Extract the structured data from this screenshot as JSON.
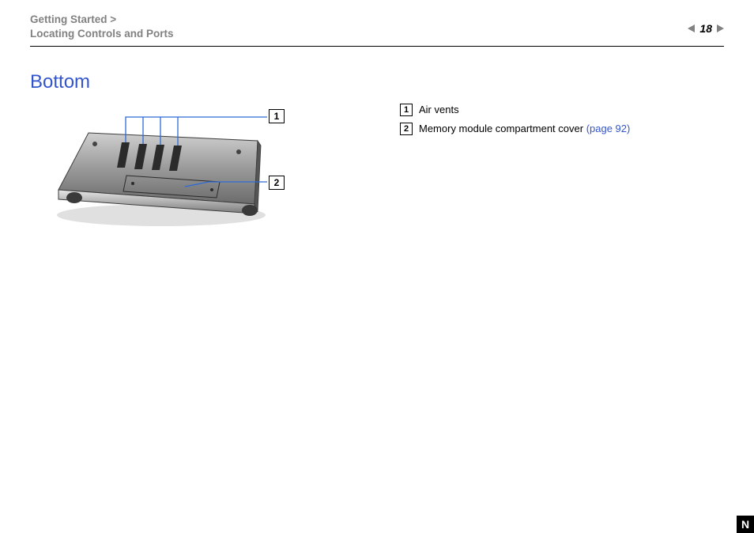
{
  "header": {
    "breadcrumb_line1": "Getting Started >",
    "breadcrumb_line2": "Locating Controls and Ports",
    "page_number": "18"
  },
  "section": {
    "title": "Bottom"
  },
  "diagram": {
    "callouts": {
      "c1": "1",
      "c2": "2"
    }
  },
  "legend": {
    "items": [
      {
        "num": "1",
        "text": "Air vents",
        "link": ""
      },
      {
        "num": "2",
        "text": "Memory module compartment cover ",
        "link": "(page 92)"
      }
    ]
  },
  "corner_mark": "N"
}
